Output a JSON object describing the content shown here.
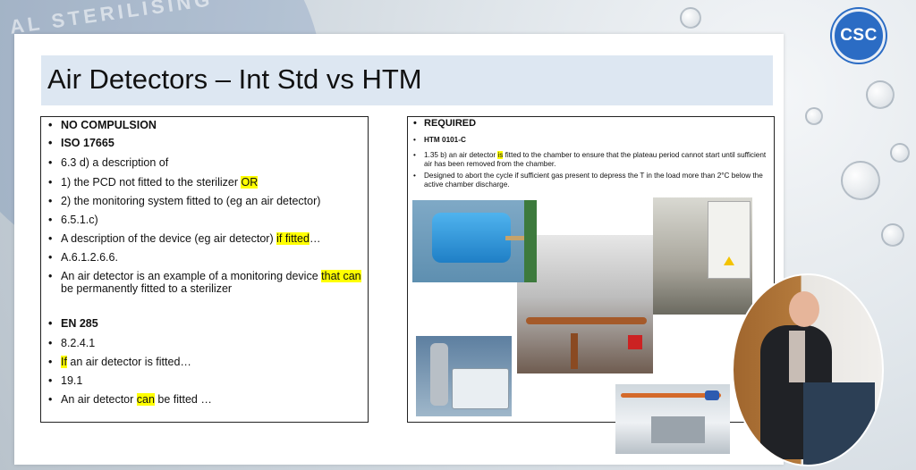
{
  "logo": {
    "text": "CSC"
  },
  "background": {
    "emblem_text": "AL STERILISING"
  },
  "slide": {
    "title": "Air Detectors – Int Std vs HTM",
    "left": {
      "items": [
        {
          "text": "NO COMPULSION"
        },
        {
          "text": "ISO 17665"
        },
        {
          "text": "6.3 d) a description of"
        },
        {
          "pre": "1) the PCD not fitted to the sterilizer ",
          "hl": "OR",
          "post": ""
        },
        {
          "text": "2) the monitoring system fitted to (eg an air detector)"
        },
        {
          "text": "6.5.1.c)"
        },
        {
          "pre": "A description of the device (eg air detector) ",
          "hl": "if fitted",
          "post": "…"
        },
        {
          "text": "A.6.1.2.6.6."
        },
        {
          "pre": "An air detector is an example of a monitoring device ",
          "hl": "that can",
          "post": " be permanently fitted to a sterilizer"
        },
        {
          "text": "EN 285"
        },
        {
          "text": "8.2.4.1"
        },
        {
          "pre": "",
          "hl": "If",
          "post": " an air detector is fitted…"
        },
        {
          "text": "19.1"
        },
        {
          "pre": "An air detector ",
          "hl": "can",
          "post": " be fitted …"
        }
      ]
    },
    "right": {
      "required": "REQUIRED",
      "htm": "HTM 0101-C",
      "p1_pre": "1.35 b) an air detector ",
      "p1_hl": "is",
      "p1_post": " fitted to the chamber to ensure that the plateau period cannot start until sufficient air has been removed from the chamber.",
      "p2": "Designed to abort the cycle if sufficient gas present to depress the T in the load more than 2°C below the active chamber discharge."
    }
  }
}
